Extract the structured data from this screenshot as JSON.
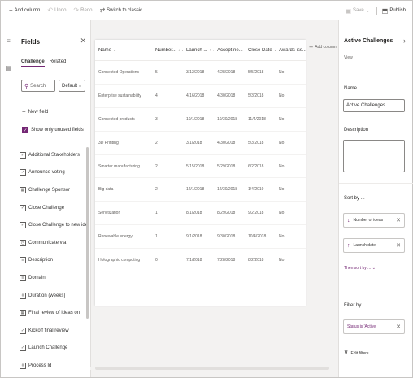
{
  "toolbar": {
    "add_column": "Add column",
    "undo": "Undo",
    "redo": "Redo",
    "switch_classic": "Switch to classic",
    "save": "Save",
    "publish": "Publish"
  },
  "fields_panel": {
    "title": "Fields",
    "tabs": [
      "Challenge",
      "Related"
    ],
    "search_placeholder": "Search",
    "filter_value": "Default",
    "new_field": "New field",
    "show_unused": "Show only unused fields",
    "items": [
      {
        "label": "Additional Stakeholders",
        "icon": "checkbox-icon"
      },
      {
        "label": "Announce voting",
        "icon": "checkbox-icon"
      },
      {
        "label": "Challenge Sponsor",
        "icon": "lookup-icon"
      },
      {
        "label": "Close Challenge",
        "icon": "checkbox-icon"
      },
      {
        "label": "Close Challenge to new ideas",
        "icon": "checkbox-icon"
      },
      {
        "label": "Communicate via",
        "icon": "option-icon"
      },
      {
        "label": "Description",
        "icon": "text-icon"
      },
      {
        "label": "Domain",
        "icon": "text-icon"
      },
      {
        "label": "Duration (weeks)",
        "icon": "number-icon"
      },
      {
        "label": "Final review of ideas on",
        "icon": "calendar-icon"
      },
      {
        "label": "Kickoff final review",
        "icon": "checkbox-icon"
      },
      {
        "label": "Launch Challenge",
        "icon": "checkbox-icon"
      },
      {
        "label": "Process Id",
        "icon": "number-icon"
      }
    ]
  },
  "grid": {
    "columns": [
      {
        "label": "Name",
        "indicator": "⌄"
      },
      {
        "label": "Number...",
        "indicator": "↓ ⌄"
      },
      {
        "label": "Launch ...",
        "indicator": "↑ ⌄"
      },
      {
        "label": "Accept ne...",
        "indicator": "⌄"
      },
      {
        "label": "Close Date",
        "indicator": "⌄"
      },
      {
        "label": "Awards iss...",
        "indicator": "⌄"
      }
    ],
    "add_column": "Add column",
    "rows": [
      [
        "Connected Operations",
        "5",
        "3/12/2018",
        "4/28/2018",
        "5/5/2018",
        "No"
      ],
      [
        "Enterprise sustainability",
        "4",
        "4/16/2018",
        "4/30/2018",
        "5/3/2018",
        "No"
      ],
      [
        "Connected products",
        "3",
        "10/1/2018",
        "10/30/2018",
        "11/4/2018",
        "No"
      ],
      [
        "3D Printing",
        "2",
        "3/1/2018",
        "4/30/2018",
        "5/3/2018",
        "No"
      ],
      [
        "Smarter manufacturing",
        "2",
        "5/15/2018",
        "5/29/2018",
        "6/2/2018",
        "No"
      ],
      [
        "Big data",
        "2",
        "12/1/2018",
        "12/30/2018",
        "1/4/2019",
        "No"
      ],
      [
        "Servitization",
        "1",
        "8/1/2018",
        "8/29/2018",
        "9/2/2018",
        "No"
      ],
      [
        "Renewable energy",
        "1",
        "9/1/2018",
        "9/30/2018",
        "10/4/2018",
        "No"
      ],
      [
        "Holographic computing",
        "0",
        "7/1/2018",
        "7/28/2018",
        "8/2/2018",
        "No"
      ]
    ]
  },
  "properties": {
    "title": "Active Challenges",
    "subtitle": "View",
    "name_label": "Name",
    "name_value": "Active Challenges",
    "description_label": "Description",
    "sort_label": "Sort by ...",
    "sort_items": [
      {
        "label": "Number of ideas",
        "direction": "↓"
      },
      {
        "label": "Launch date",
        "direction": "↑"
      }
    ],
    "then_sort": "Then sort by ... ⌄",
    "filter_label": "Filter by ...",
    "filter_item": "Status is 'Active'",
    "edit_filters": "Edit filters ..."
  },
  "colors": {
    "accent": "#742774"
  }
}
